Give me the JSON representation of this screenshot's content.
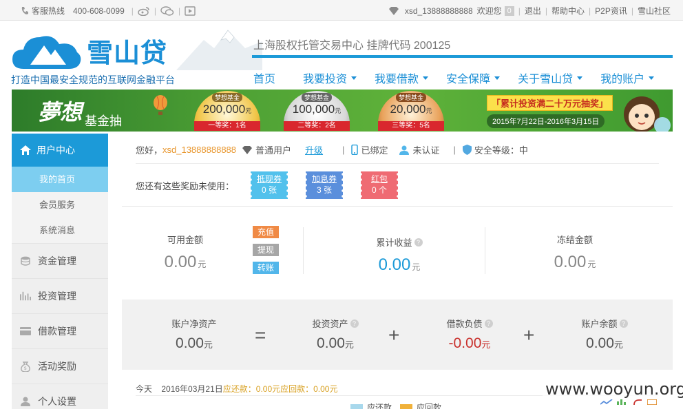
{
  "topbar": {
    "hotline_label": "客服热线",
    "hotline_number": "400-608-0099",
    "username": "xsd_13888888888",
    "welcome": "欢迎您",
    "msg_count": "0",
    "links": [
      "退出",
      "帮助中心",
      "P2P资讯",
      "雪山社区"
    ]
  },
  "header": {
    "logo_text": "雪山贷",
    "slogan": "打造中国最安全规范的互联网金融平台",
    "exchange_text": "上海股权托管交易中心 挂牌代码 200125",
    "nav": [
      {
        "label": "首页",
        "caret": false
      },
      {
        "label": "我要投资",
        "caret": true
      },
      {
        "label": "我要借款",
        "caret": true
      },
      {
        "label": "安全保障",
        "caret": true
      },
      {
        "label": "关于雪山贷",
        "caret": true
      },
      {
        "label": "我的账户",
        "caret": true
      }
    ]
  },
  "banner": {
    "title": "夢想",
    "subtitle": "基金抽",
    "prizes": [
      {
        "tag": "梦想基金",
        "amount": "200,000",
        "unit": "元",
        "rank": "一等奖：1名"
      },
      {
        "tag": "梦想基金",
        "amount": "100,000",
        "unit": "元",
        "rank": "二等奖：2名"
      },
      {
        "tag": "梦想基金",
        "amount": "20,000",
        "unit": "元",
        "rank": "三等奖：5名"
      }
    ],
    "promo": "「累计投资满二十万元抽奖」",
    "date_range": "2015年7月22日-2016年3月15日"
  },
  "sidebar": {
    "head": "用户中心",
    "subitems": [
      "我的首页",
      "会员服务",
      "系统消息"
    ],
    "items": [
      "资金管理",
      "投资管理",
      "借款管理",
      "活动奖励",
      "个人设置"
    ]
  },
  "user": {
    "greeting": "您好，",
    "name": "xsd_13888888888",
    "level": "普通用户",
    "upgrade": "升级",
    "phone_status": "已绑定",
    "id_status": "未认证",
    "security": "安全等级：中"
  },
  "rewards": {
    "label": "您还有这些奖励未使用：",
    "tickets": [
      {
        "name": "抵现券",
        "count": "0 张"
      },
      {
        "name": "加息券",
        "count": "3 张"
      },
      {
        "name": "红包",
        "count": "0 个"
      }
    ]
  },
  "stats": {
    "available": {
      "label": "可用金额",
      "value": "0.00",
      "unit": "元"
    },
    "buttons": [
      "充值",
      "提现",
      "转账"
    ],
    "earnings": {
      "label": "累计收益",
      "value": "0.00",
      "unit": "元"
    },
    "frozen": {
      "label": "冻结金额",
      "value": "0.00",
      "unit": "元"
    }
  },
  "equation": {
    "net": {
      "label": "账户净资产",
      "value": "0.00",
      "unit": "元"
    },
    "invest": {
      "label": "投资资产",
      "value": "0.00",
      "unit": "元"
    },
    "debt": {
      "label": "借款负债",
      "value": "-0.00",
      "unit": "元"
    },
    "balance": {
      "label": "账户余额",
      "value": "0.00",
      "unit": "元"
    },
    "ops": [
      "=",
      "+",
      "+"
    ]
  },
  "today": {
    "label": "今天",
    "date": "2016年03月21日",
    "repay": "应还款：0.00元",
    "receive": "应回款：0.00元"
  },
  "legend": {
    "repay": "应还款",
    "receive": "应回款"
  },
  "colors": {
    "accent": "#1c9ad8",
    "debt": "#c9302c",
    "orange": "#f08a45"
  },
  "watermark": "www.wooyun.org"
}
